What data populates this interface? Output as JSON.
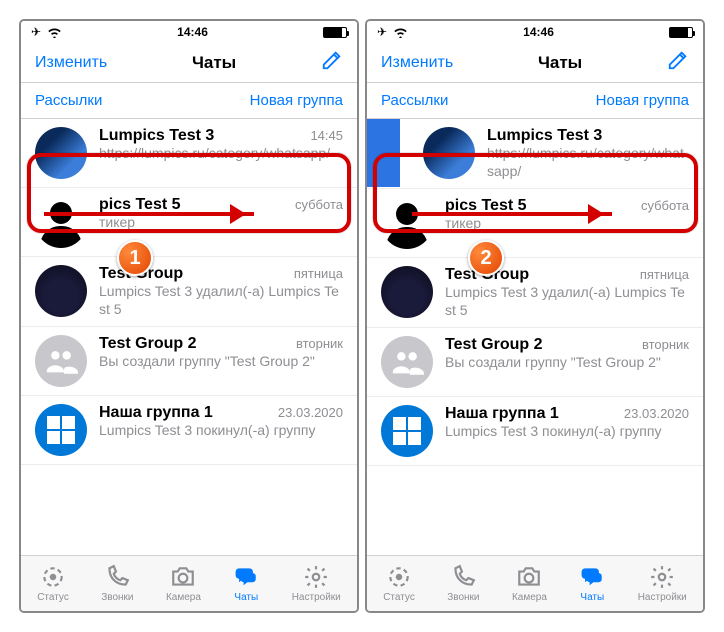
{
  "status": {
    "time": "14:46"
  },
  "nav": {
    "edit": "Изменить",
    "title": "Чаты"
  },
  "subnav": {
    "broadcasts": "Рассылки",
    "newgroup": "Новая группа"
  },
  "chats": [
    {
      "name": "Lumpics Test 3",
      "time": "14:45",
      "preview": "https://lumpics.ru/category/whatsapp/"
    },
    {
      "name": "pics Test 5",
      "time": "суббота",
      "preview": "тикер"
    },
    {
      "name": "Test Group",
      "time": "пятница",
      "preview": "Lumpics Test 3 удалил(-а) Lumpics Test 5"
    },
    {
      "name": "Test Group 2",
      "time": "вторник",
      "preview": "Вы создали группу \"Test Group 2\""
    },
    {
      "name": "Наша группа 1",
      "time": "23.03.2020",
      "preview": "Lumpics Test 3 покинул(-а) группу"
    }
  ],
  "tabs": {
    "status": "Статус",
    "calls": "Звонки",
    "camera": "Камера",
    "chats": "Чаты",
    "settings": "Настройки"
  },
  "steps": {
    "one": "1",
    "two": "2"
  }
}
